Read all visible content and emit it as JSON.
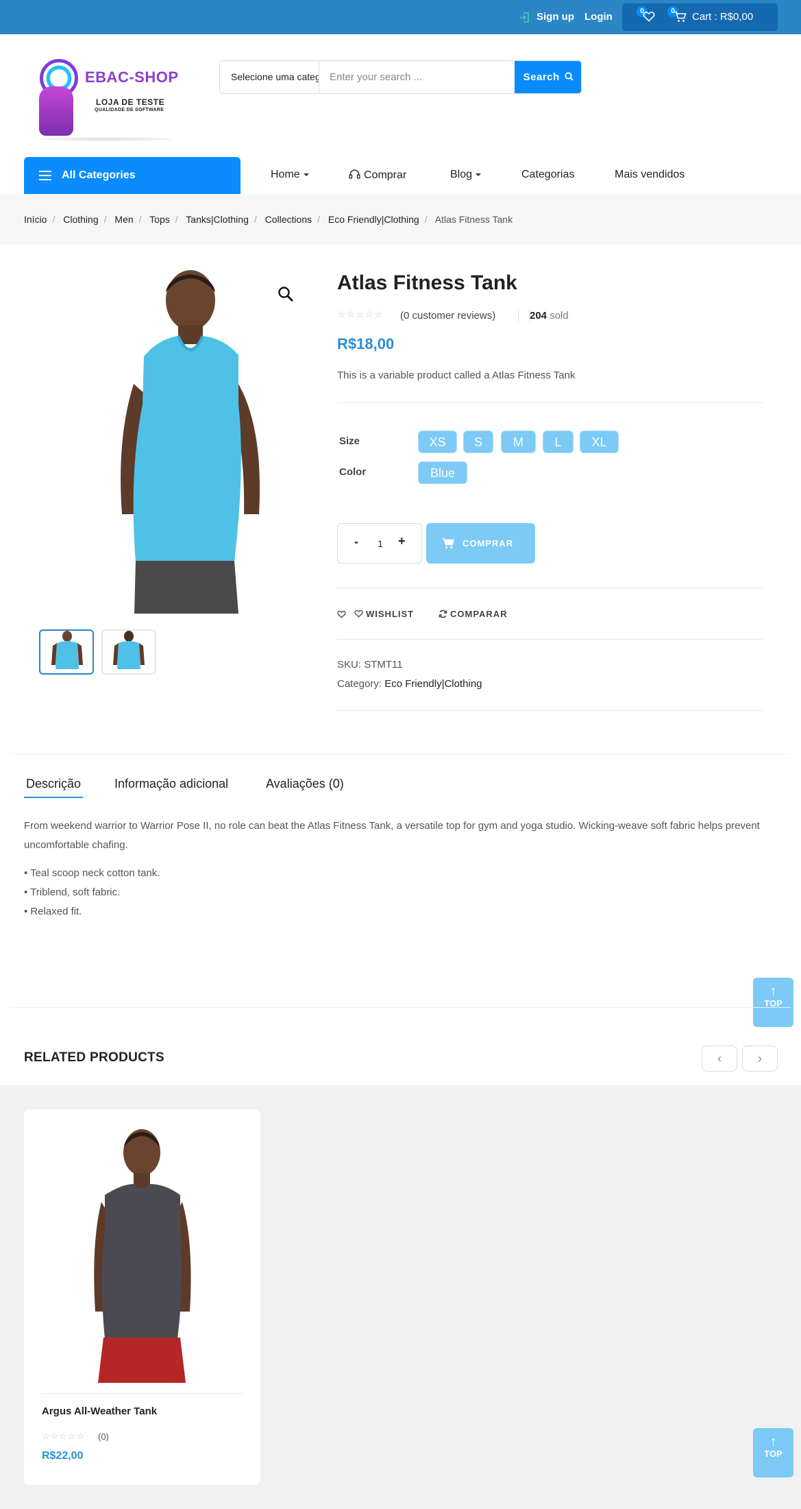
{
  "topbar": {
    "signup": "Sign up",
    "login": "Login",
    "wishlist_count": "0",
    "cart_count": "0",
    "cart_label": "Cart : R$0,00"
  },
  "logo": {
    "title": "EBAC-SHOP",
    "subtitle": "LOJA DE TESTE",
    "tagline": "QUALIDADE DE SOFTWARE"
  },
  "search": {
    "category": "Selecione uma categoria",
    "placeholder": "Enter your search ...",
    "button": "Search"
  },
  "nav": {
    "all_categories": "All Categories",
    "items": [
      "Home",
      "Comprar",
      "Blog",
      "Categorias",
      "Mais vendidos"
    ]
  },
  "breadcrumb": [
    "Início",
    "Clothing",
    "Men",
    "Tops",
    "Tanks|Clothing",
    "Collections",
    "Eco Friendly|Clothing",
    "Atlas Fitness Tank"
  ],
  "product": {
    "title": "Atlas Fitness Tank",
    "reviews": "(0 customer reviews)",
    "sold_count": "204",
    "sold_label": "sold",
    "rating": 0,
    "price": "R$18,00",
    "short_description": "This is a variable product called a Atlas Fitness Tank",
    "size_label": "Size",
    "sizes": [
      "XS",
      "S",
      "M",
      "L",
      "XL"
    ],
    "color_label": "Color",
    "colors": [
      "Blue"
    ],
    "quantity": "1",
    "qty_minus": "-",
    "qty_plus": "+",
    "buy_label": "COMPRAR",
    "wishlist_label": "WISHLIST",
    "compare_label": "COMPARAR",
    "sku_label": "SKU:",
    "sku": "STMT11",
    "category_label": "Category:",
    "category": "Eco Friendly|Clothing"
  },
  "tabs": {
    "items": [
      "Descrição",
      "Informação adicional",
      "Avaliações (0)"
    ],
    "description": "From weekend warrior to Warrior Pose II, no role can beat the Atlas Fitness Tank, a versatile top for gym and yoga studio. Wicking-weave soft fabric helps prevent uncomfortable chafing.",
    "bullets": [
      "• Teal scoop neck cotton tank.",
      "• Triblend, soft fabric.",
      "• Relaxed fit."
    ]
  },
  "top_button": "TOP",
  "related": {
    "title": "RELATED PRODUCTS",
    "products": [
      {
        "name": "Argus All-Weather Tank",
        "count": "(0)",
        "price": "R$22,00"
      }
    ]
  },
  "colors": {
    "topbar": "#2b86c5",
    "accent": "#0a8cff",
    "price": "#2b8fd8",
    "swatch": "#7ccaf5"
  }
}
